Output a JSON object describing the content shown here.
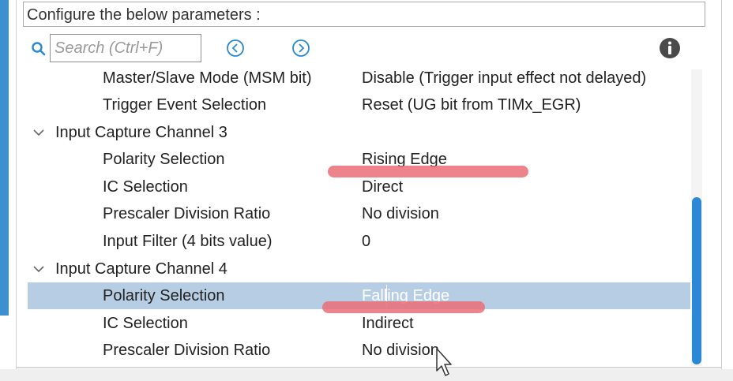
{
  "header": {
    "title": "Configure the below parameters :"
  },
  "search": {
    "placeholder": "Search (Ctrl+F)",
    "value": ""
  },
  "icons": {
    "search": "search-icon",
    "prev": "chevron-left-circle-icon",
    "next": "chevron-right-circle-icon",
    "info": "info-icon",
    "group_toggle": "chevron-down-icon"
  },
  "rows": [
    {
      "name": "Master/Slave Mode (MSM bit)",
      "value": "Disable (Trigger input effect not delayed)"
    },
    {
      "name": "Trigger Event Selection",
      "value": "Reset (UG bit from TIMx_EGR)"
    }
  ],
  "group3": {
    "title": "Input Capture Channel 3",
    "params": [
      {
        "name": "Polarity Selection",
        "value": "Rising Edge"
      },
      {
        "name": "IC Selection",
        "value": "Direct"
      },
      {
        "name": "Prescaler Division Ratio",
        "value": "No division"
      },
      {
        "name": "Input Filter (4 bits value)",
        "value": "0"
      }
    ]
  },
  "group4": {
    "title": "Input Capture Channel 4",
    "params": [
      {
        "name": "Polarity Selection",
        "value": "Falling Edge",
        "selected": true
      },
      {
        "name": "IC Selection",
        "value": "Indirect"
      },
      {
        "name": "Prescaler Division Ratio",
        "value": "No division"
      }
    ]
  },
  "colors": {
    "selection": "#b7cde3",
    "accent": "#2a88d4",
    "annotation": "#ea6f77"
  }
}
